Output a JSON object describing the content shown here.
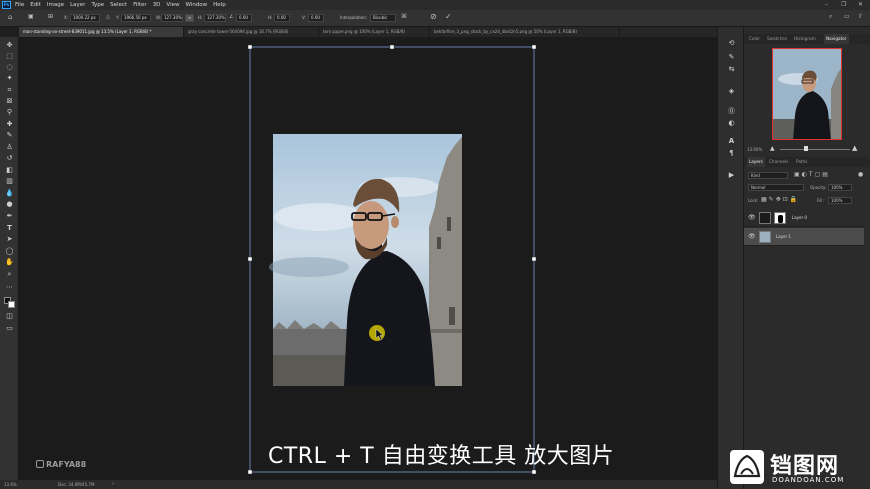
{
  "menubar": {
    "logo": "Ps",
    "items": [
      "File",
      "Edit",
      "Image",
      "Layer",
      "Type",
      "Select",
      "Filter",
      "3D",
      "View",
      "Window",
      "Help"
    ],
    "controls": [
      "–",
      "❐",
      "✕"
    ]
  },
  "options": {
    "x_label": "X:",
    "x_value": "1000.22 px",
    "y_label": "Y:",
    "y_value": "1966.50 px",
    "w_label": "W:",
    "w_value": "127.30%",
    "h_label": "H:",
    "h_value": "127.30%",
    "angle_value": "0.00",
    "h_skew_label": "H:",
    "h_skew_value": "0.00",
    "v_skew_label": "V:",
    "v_skew_value": "0.00",
    "interp_label": "Interpolation:",
    "interp_value": "Bicubic"
  },
  "tabs": [
    {
      "label": "man-standing-on-street-839011.jpg @ 13.5% (Layer 1, RGB/8) *"
    },
    {
      "label": "gray concrete tower-564094.jpg @ 16.7% (RGB/8)"
    },
    {
      "label": "torn paper.png @ 100% (Layer 1, RGB/8)"
    },
    {
      "label": "bekforfkre_3_png_stock_by_cx24_dbst2n5.png @ 50% (Layer 1, RGB/8)"
    }
  ],
  "statusbar": {
    "zoom": "13.6%",
    "doc": "Doc: 34.0M/45.7M"
  },
  "navigator": {
    "tabs": [
      "Color",
      "Swatches",
      "Histogram",
      "Navigator"
    ],
    "zoom": "13.60%"
  },
  "layers_panel": {
    "tabs": [
      "Layers",
      "Channels",
      "Paths"
    ],
    "kind_placeholder": "Kind",
    "blend_mode": "Normal",
    "opacity_label": "Opacity:",
    "opacity_value": "100%",
    "lock_label": "Lock:",
    "fill_label": "Fill:",
    "fill_value": "100%",
    "layers": [
      {
        "name": "Layer 0"
      },
      {
        "name": "Layer 1"
      }
    ]
  },
  "caption": "CTRL + T 自由变换工具 放大图片",
  "watermark_left": "RAFYA88",
  "watermark_right": {
    "cn": "铛图网",
    "en": "DOANDOAN.COM"
  },
  "colors": {
    "accent": "#31a8ff",
    "transform_box": "#7c9bd8",
    "cursor": "#c8b800",
    "nav_frame": "#e03030"
  },
  "icons": [
    "move-icon",
    "marquee-icon",
    "lasso-icon",
    "magic-wand-icon",
    "crop-icon",
    "eyedropper-icon",
    "healing-icon",
    "brush-icon",
    "stamp-icon",
    "history-brush-icon",
    "eraser-icon",
    "gradient-icon",
    "blur-icon",
    "dodge-icon",
    "pen-icon",
    "type-icon",
    "path-select-icon",
    "shape-icon",
    "hand-icon",
    "zoom-icon"
  ]
}
